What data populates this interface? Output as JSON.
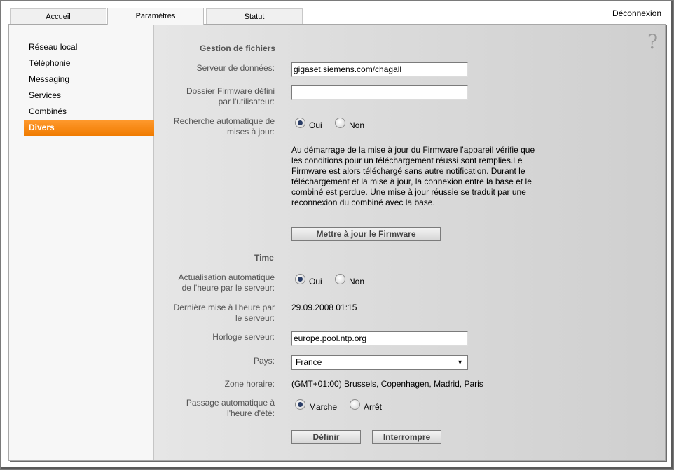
{
  "tabs": [
    {
      "label": "Accueil"
    },
    {
      "label": "Paramètres"
    },
    {
      "label": "Statut"
    }
  ],
  "logout_label": "Déconnexion",
  "help_symbol": "?",
  "sidebar": {
    "items": [
      {
        "label": "Réseau local"
      },
      {
        "label": "Téléphonie"
      },
      {
        "label": "Messaging"
      },
      {
        "label": "Services"
      },
      {
        "label": "Combinés"
      },
      {
        "label": "Divers"
      }
    ],
    "accent_color": "#f7860f"
  },
  "file_management": {
    "section_title": "Gestion de fichiers",
    "data_server_label": "Serveur de données:",
    "data_server_value": "gigaset.siemens.com/chagall",
    "firmware_folder_label_1": "Dossier Firmware défini",
    "firmware_folder_label_2": "par l'utilisateur:",
    "firmware_folder_value": "",
    "auto_update_label_1": "Recherche automatique de",
    "auto_update_label_2": "mises à jour:",
    "yes_label": "Oui",
    "no_label": "Non",
    "info_text": "Au démarrage de la mise à jour du Firmware l'appareil vérifie que les conditions pour un téléchargement réussi sont remplies.Le Firmware est alors téléchargé sans autre notification. Durant le téléchargement et la mise à jour, la connexion entre la base et le combiné est perdue. Une mise à jour réussie se traduit par une reconnexion du combiné avec la base.",
    "update_button": "Mettre à jour le Firmware"
  },
  "time": {
    "section_title": "Time",
    "auto_time_label_1": "Actualisation automatique",
    "auto_time_label_2": "de l'heure par le serveur:",
    "yes_label": "Oui",
    "no_label": "Non",
    "last_update_label_1": "Dernière mise à l'heure par",
    "last_update_label_2": "le serveur:",
    "last_update_value": "29.09.2008 01:15",
    "time_server_label": "Horloge serveur:",
    "time_server_value": "europe.pool.ntp.org",
    "country_label": "Pays:",
    "country_value": "France",
    "timezone_label": "Zone horaire:",
    "timezone_value": "(GMT+01:00) Brussels, Copenhagen, Madrid, Paris",
    "dst_label_1": "Passage automatique à",
    "dst_label_2": "l'heure d'été:",
    "dst_on_label": "Marche",
    "dst_off_label": "Arrêt"
  },
  "actions": {
    "define_button": "Définir",
    "cancel_button": "Interrompre"
  }
}
